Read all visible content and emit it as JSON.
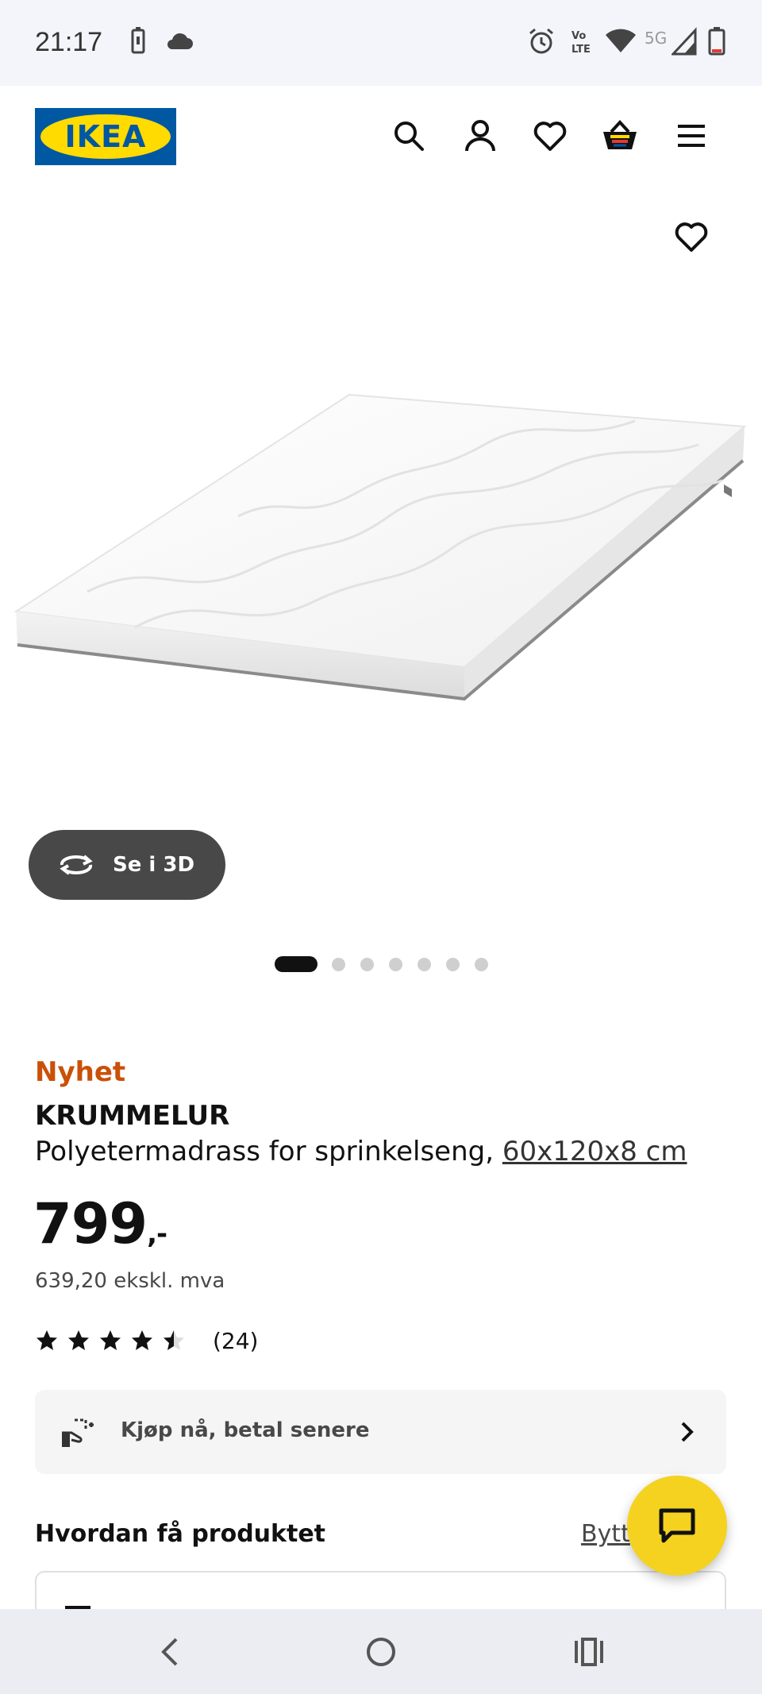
{
  "status_bar": {
    "time": "21:17",
    "network": "5G",
    "icons": [
      "battery-saver-icon",
      "cloud-icon",
      "alarm-icon",
      "volte-icon",
      "wifi-icon",
      "signal-icon",
      "battery-icon"
    ]
  },
  "header": {
    "logo_text": "IKEA",
    "icons": [
      "search-icon",
      "account-icon",
      "heart-icon",
      "basket-icon",
      "menu-icon"
    ]
  },
  "gallery": {
    "view_3d_label": "Se i 3D",
    "image_count": 7,
    "active_index": 0
  },
  "product": {
    "badge": "Nyhet",
    "name": "KRUMMELUR",
    "description": "Polyetermadrass for sprinkelseng, ",
    "size": "60x120x8 cm",
    "price": "799",
    "price_suffix": ",-",
    "price_ex_vat": "639,20 ekskl. mva",
    "rating": 4.5,
    "rating_count": "(24)"
  },
  "paylater": {
    "label": "Kjøp nå, betal senere"
  },
  "availability": {
    "heading": "Hvordan få produktet",
    "change_label": "Bytt"
  },
  "colors": {
    "brand_blue": "#0058a3",
    "brand_yellow": "#ffdb00",
    "badge_orange": "#ca5008",
    "chat_yellow": "#f5d21f"
  },
  "nav_bar": {
    "icons": [
      "back-icon",
      "home-icon",
      "recents-icon"
    ]
  }
}
